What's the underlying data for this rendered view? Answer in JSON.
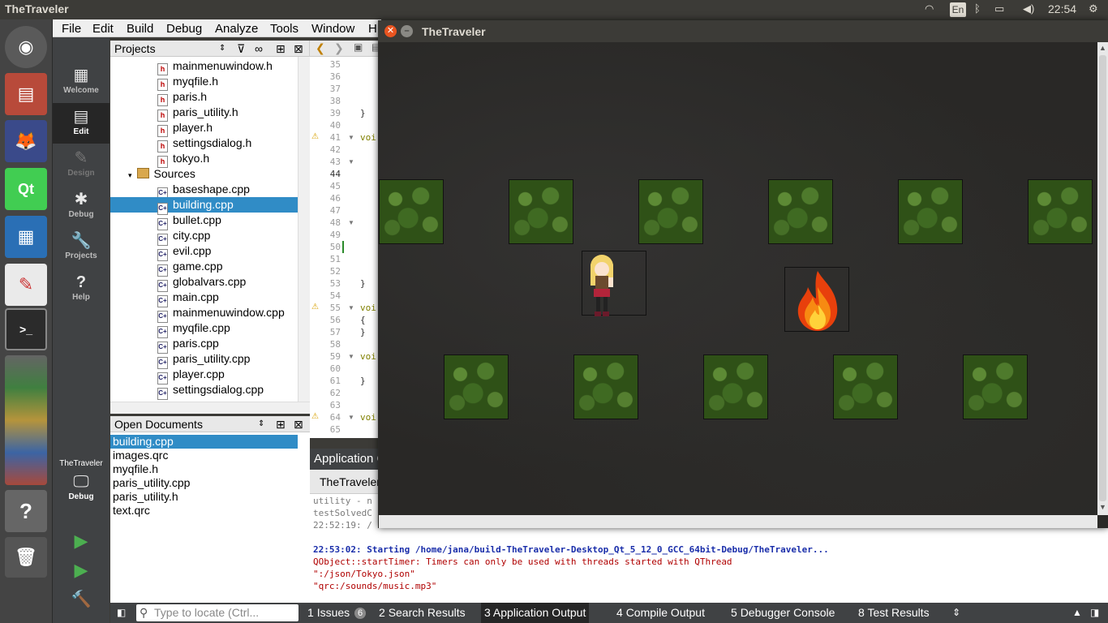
{
  "top_panel": {
    "title": "TheTraveler",
    "lang": "En",
    "clock": "22:54"
  },
  "menubar": [
    "File",
    "Edit",
    "Build",
    "Debug",
    "Analyze",
    "Tools",
    "Window",
    "H"
  ],
  "modes": {
    "welcome": "Welcome",
    "edit": "Edit",
    "design": "Design",
    "debug": "Debug",
    "projects": "Projects",
    "help": "Help",
    "kit_project": "TheTraveler",
    "kit_mode": "Debug"
  },
  "projects_panel": {
    "title": "Projects",
    "headers": [
      "mainmenuwindow.h",
      "myqfile.h",
      "paris.h",
      "paris_utility.h",
      "player.h",
      "settingsdialog.h",
      "tokyo.h"
    ],
    "sources_label": "Sources",
    "sources": [
      "baseshape.cpp",
      "building.cpp",
      "bullet.cpp",
      "city.cpp",
      "evil.cpp",
      "game.cpp",
      "globalvars.cpp",
      "main.cpp",
      "mainmenuwindow.cpp",
      "myqfile.cpp",
      "paris.cpp",
      "paris_utility.cpp",
      "player.cpp",
      "settingsdialog.cpp"
    ],
    "selected": "building.cpp"
  },
  "open_documents": {
    "title": "Open Documents",
    "items": [
      "building.cpp",
      "images.qrc",
      "myqfile.h",
      "paris_utility.cpp",
      "paris_utility.h",
      "text.qrc"
    ],
    "selected": "building.cpp"
  },
  "editor": {
    "lines": [
      "35",
      "36",
      "37",
      "38",
      "39",
      "40",
      "41",
      "42",
      "43",
      "44",
      "45",
      "46",
      "47",
      "48",
      "49",
      "50",
      "51",
      "52",
      "53",
      "54",
      "55",
      "56",
      "57",
      "58",
      "59",
      "60",
      "61",
      "62",
      "63",
      "64",
      "65"
    ],
    "code": {
      "39": "}",
      "41": "voi",
      "53": "}",
      "55": "voi",
      "56": "{",
      "57": "}",
      "59": "voi",
      "61": "}",
      "64": "voi"
    }
  },
  "output": {
    "header": "Application Output",
    "tab": "TheTraveler",
    "lines": [
      {
        "text": "utility - n",
        "style": "gray"
      },
      {
        "text": "testSolvedC",
        "style": "gray"
      },
      {
        "text": "22:52:19: /",
        "style": "gray"
      },
      {
        "text": "",
        "style": "gray"
      },
      {
        "text": "22:53:02: Starting /home/jana/build-TheTraveler-Desktop_Qt_5_12_0_GCC_64bit-Debug/TheTraveler...",
        "style": "blue"
      },
      {
        "text": "QObject::startTimer: Timers can only be used with threads started with QThread",
        "style": "red"
      },
      {
        "text": "\":/json/Tokyo.json\"",
        "style": "red"
      },
      {
        "text": "\"qrc:/sounds/music.mp3\"",
        "style": "red"
      }
    ]
  },
  "statusbar": {
    "locate_placeholder": "Type to locate (Ctrl...",
    "tabs": [
      {
        "num": "1",
        "label": "Issues",
        "badge": "6"
      },
      {
        "num": "2",
        "label": "Search Results"
      },
      {
        "num": "3",
        "label": "Application Output"
      },
      {
        "num": "4",
        "label": "Compile Output"
      },
      {
        "num": "5",
        "label": "Debugger Console"
      },
      {
        "num": "8",
        "label": "Test Results"
      }
    ]
  },
  "game_window": {
    "title": "TheTraveler"
  }
}
